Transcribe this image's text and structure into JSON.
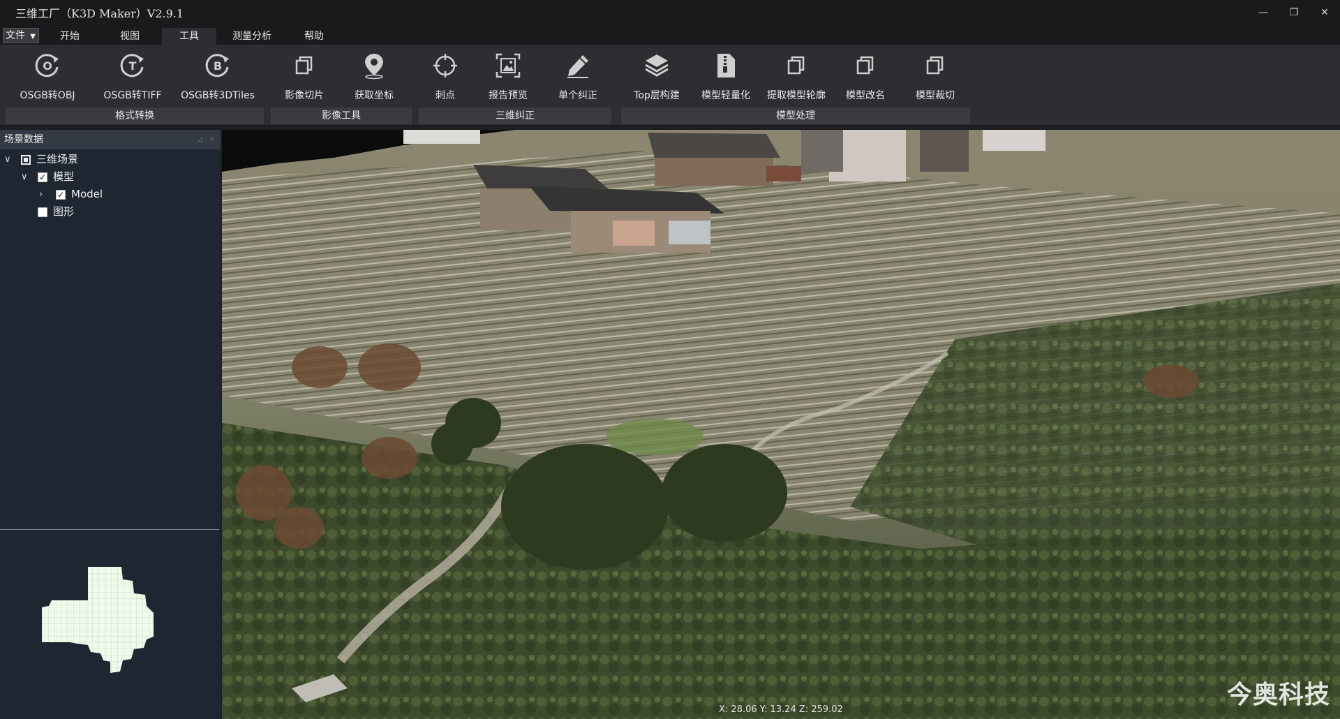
{
  "window": {
    "title": "三维工厂（K3D Maker）V2.9.1",
    "controls": [
      "—",
      "❐",
      "✕"
    ]
  },
  "menu": {
    "file": "文件",
    "tabs": [
      "开始",
      "视图",
      "工具",
      "测量分析",
      "帮助"
    ],
    "active_tab": "工具"
  },
  "ribbon": {
    "buttons": [
      {
        "label": "OSGB转OBJ",
        "icon": "circle-o-icon"
      },
      {
        "label": "OSGB转TIFF",
        "icon": "circle-t-icon"
      },
      {
        "label": "OSGB转3DTiles",
        "icon": "circle-b-icon"
      },
      {
        "label": "影像切片",
        "icon": "copy-icon"
      },
      {
        "label": "获取坐标",
        "icon": "location-pin-icon"
      },
      {
        "label": "刺点",
        "icon": "crosshair-icon"
      },
      {
        "label": "报告预览",
        "icon": "image-frame-icon"
      },
      {
        "label": "单个纠正",
        "icon": "pencil-icon"
      },
      {
        "label": "Top层构建",
        "icon": "layers-icon"
      },
      {
        "label": "模型轻量化",
        "icon": "compress-file-icon"
      },
      {
        "label": "提取模型轮廓",
        "icon": "copy-icon"
      },
      {
        "label": "模型改名",
        "icon": "copy-icon"
      },
      {
        "label": "模型裁切",
        "icon": "copy-icon"
      }
    ],
    "groups": [
      "格式转换",
      "影像工具",
      "三维纠正",
      "模型处理"
    ]
  },
  "scene_panel": {
    "title": "场景数据",
    "tree": [
      {
        "label": "三维场景",
        "state": "partial"
      },
      {
        "label": "模型",
        "state": "checked"
      },
      {
        "label": "Model",
        "state": "checked"
      },
      {
        "label": "图形",
        "state": "unchecked"
      }
    ]
  },
  "status": {
    "coords": "X: 28.06 Y: 13.24  Z: 259.02"
  },
  "watermark": "今奥科技",
  "colors": {
    "panel_bg": "#1e2632",
    "ribbon_bg": "#2d2e31",
    "minimap_fill": "#eefaea"
  }
}
